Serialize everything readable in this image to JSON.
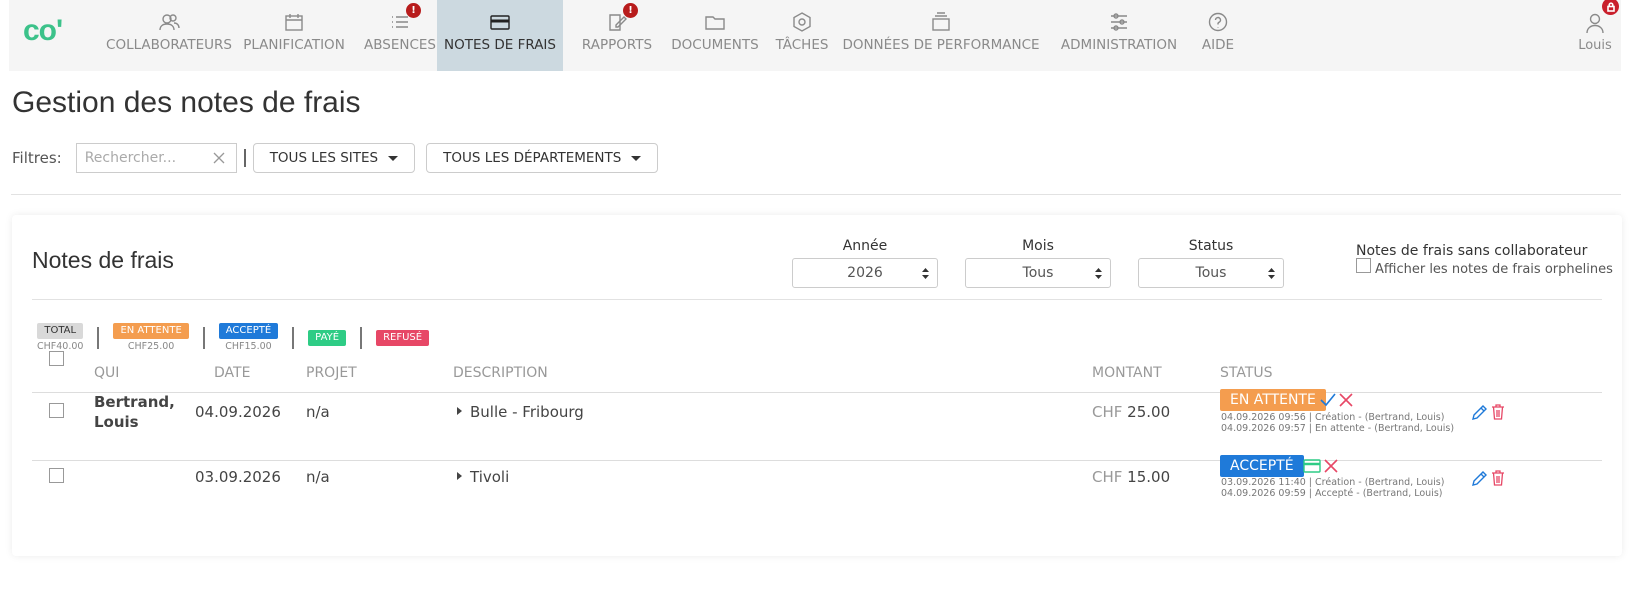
{
  "nav": {
    "logo": "co'",
    "items": [
      {
        "label": "COLLABORATEURS",
        "icon": "users-icon"
      },
      {
        "label": "PLANIFICATION",
        "icon": "calendar-icon"
      },
      {
        "label": "ABSENCES",
        "icon": "list-icon",
        "badge": "!"
      },
      {
        "label": "NOTES DE FRAIS",
        "icon": "credit-card-icon",
        "active": true
      },
      {
        "label": "RAPPORTS",
        "icon": "edit-report-icon",
        "badge": "!"
      },
      {
        "label": "DOCUMENTS",
        "icon": "folder-icon"
      },
      {
        "label": "TÂCHES",
        "icon": "hexagon-icon"
      },
      {
        "label": "DONNÉES DE PERFORMANCE",
        "icon": "stack-icon"
      },
      {
        "label": "ADMINISTRATION",
        "icon": "sliders-icon"
      },
      {
        "label": "AIDE",
        "icon": "help-icon"
      }
    ],
    "user": "Louis"
  },
  "page": {
    "title": "Gestion des notes de frais",
    "filters_label": "Filtres:",
    "search_placeholder": "Rechercher...",
    "sites_button": "TOUS LES SITES",
    "departments_button": "TOUS LES DÉPARTEMENTS"
  },
  "card": {
    "title": "Notes de frais",
    "year_label": "Année",
    "year_value": "2026",
    "month_label": "Mois",
    "month_value": "Tous",
    "status_label": "Status",
    "status_value": "Tous",
    "orphan_title": "Notes de frais sans collaborateur",
    "orphan_checkbox": "Afficher les notes de frais orphelines"
  },
  "legend": [
    {
      "label": "TOTAL",
      "sub": "CHF40.00",
      "color": "#d9d9d9",
      "text_color": "#333"
    },
    {
      "label": "EN ATTENTE",
      "sub": "CHF25.00",
      "color": "#f49d4f",
      "text_color": "#fff"
    },
    {
      "label": "ACCEPTÉ",
      "sub": "CHF15.00",
      "color": "#1f7ad9",
      "text_color": "#fff"
    },
    {
      "label": "PAYÉ",
      "sub": "",
      "color": "#2ecc85",
      "text_color": "#fff"
    },
    {
      "label": "REFUSÉ",
      "sub": "",
      "color": "#e74766",
      "text_color": "#fff"
    }
  ],
  "table": {
    "headers": {
      "qui": "QUI",
      "date": "DATE",
      "projet": "PROJET",
      "description": "DESCRIPTION",
      "montant": "MONTANT",
      "status": "STATUS"
    },
    "rows": [
      {
        "qui_line1": "Bertrand,",
        "qui_line2": "Louis",
        "date": "04.09.2026",
        "projet": "n/a",
        "description": "Bulle - Fribourg",
        "currency": "CHF",
        "amount": "25.00",
        "status": "EN ATTENTE",
        "status_color": "#f49d4f",
        "history": [
          "04.09.2026 09:56 | Création - (Bertrand, Louis)",
          "04.09.2026 09:57 | En attente - (Bertrand, Louis)"
        ]
      },
      {
        "qui_line1": "",
        "qui_line2": "",
        "date": "03.09.2026",
        "projet": "n/a",
        "description": "Tivoli",
        "currency": "CHF",
        "amount": "15.00",
        "status": "ACCEPTÉ",
        "status_color": "#1f7ad9",
        "history": [
          "03.09.2026 11:40 | Création - (Bertrand, Louis)",
          "04.09.2026 09:59 | Accepté - (Bertrand, Louis)"
        ]
      }
    ]
  },
  "colors": {
    "brand": "#3cc28a",
    "active_nav": "#ccd9e0",
    "alert": "#b81c1c",
    "approve": "#1f7ad9",
    "reject": "#e74766",
    "pay": "#2ecc85"
  }
}
